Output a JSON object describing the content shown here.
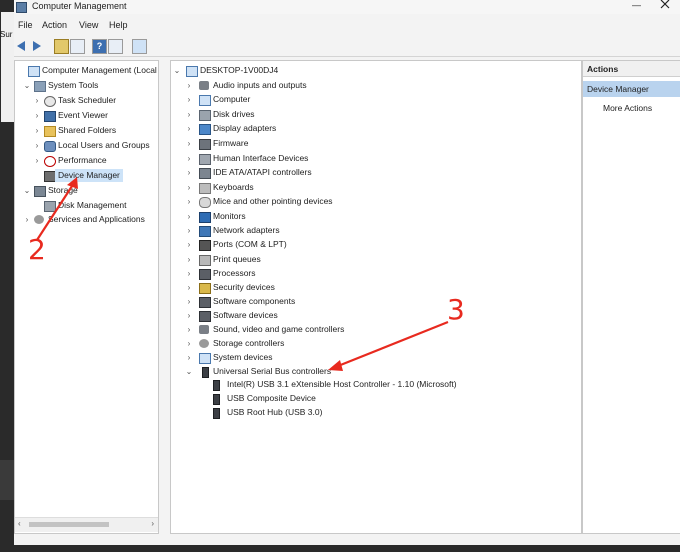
{
  "window": {
    "title": "Computer Management",
    "minimize": "—",
    "close": "×"
  },
  "side_fragment": {
    "text": "Sur"
  },
  "menu": [
    "File",
    "Action",
    "View",
    "Help"
  ],
  "left_tree": [
    {
      "label": "Computer Management (Local",
      "level": 0,
      "chev": "",
      "icon": "comp-icon"
    },
    {
      "label": "System Tools",
      "level": 1,
      "chev": "⌄",
      "icon": "tools-icon"
    },
    {
      "label": "Task Scheduler",
      "level": 2,
      "chev": "›",
      "icon": "clock-icon"
    },
    {
      "label": "Event Viewer",
      "level": 2,
      "chev": "›",
      "icon": "book-icon"
    },
    {
      "label": "Shared Folders",
      "level": 2,
      "chev": "›",
      "icon": "folder-icon"
    },
    {
      "label": "Local Users and Groups",
      "level": 2,
      "chev": "›",
      "icon": "users-icon"
    },
    {
      "label": "Performance",
      "level": 2,
      "chev": "›",
      "icon": "perf-icon"
    },
    {
      "label": "Device Manager",
      "level": 2,
      "chev": "",
      "icon": "devmgr-icon",
      "selected": true
    },
    {
      "label": "Storage",
      "level": 1,
      "chev": "⌄",
      "icon": "storage-icon"
    },
    {
      "label": "Disk Management",
      "level": 2,
      "chev": "",
      "icon": "disk-icon"
    },
    {
      "label": "Services and Applications",
      "level": 1,
      "chev": "›",
      "icon": "gear-icon"
    }
  ],
  "device_tree": {
    "root": "DESKTOP-1V00DJ4",
    "categories": [
      {
        "label": "Audio inputs and outputs",
        "icon": "audio-icon"
      },
      {
        "label": "Computer",
        "icon": "comp-icon"
      },
      {
        "label": "Disk drives",
        "icon": "disk-icon"
      },
      {
        "label": "Display adapters",
        "icon": "disp-icon"
      },
      {
        "label": "Firmware",
        "icon": "firm-icon"
      },
      {
        "label": "Human Interface Devices",
        "icon": "hid-icon"
      },
      {
        "label": "IDE ATA/ATAPI controllers",
        "icon": "drive-icon"
      },
      {
        "label": "Keyboards",
        "icon": "kbd-icon"
      },
      {
        "label": "Mice and other pointing devices",
        "icon": "mouse-icon"
      },
      {
        "label": "Monitors",
        "icon": "mon-icon"
      },
      {
        "label": "Network adapters",
        "icon": "net-icon"
      },
      {
        "label": "Ports (COM & LPT)",
        "icon": "port-icon"
      },
      {
        "label": "Print queues",
        "icon": "print-icon"
      },
      {
        "label": "Processors",
        "icon": "chip-icon"
      },
      {
        "label": "Security devices",
        "icon": "key-icon"
      },
      {
        "label": "Software components",
        "icon": "chip-icon"
      },
      {
        "label": "Software devices",
        "icon": "chip-icon"
      },
      {
        "label": "Sound, video and game controllers",
        "icon": "audio-icon"
      },
      {
        "label": "Storage controllers",
        "icon": "gear-icon"
      },
      {
        "label": "System devices",
        "icon": "comp-icon"
      },
      {
        "label": "Universal Serial Bus controllers",
        "icon": "usb-icon",
        "expanded": true
      }
    ],
    "usb_children": [
      "Intel(R) USB 3.1 eXtensible Host Controller - 1.10 (Microsoft)",
      "USB Composite Device",
      "USB Root Hub (USB 3.0)"
    ]
  },
  "actions": {
    "header": "Actions",
    "selected": "Device Manager",
    "more": "More Actions"
  },
  "annotations": {
    "label_2": "2",
    "label_3": "3",
    "color": "#e82a1f"
  }
}
